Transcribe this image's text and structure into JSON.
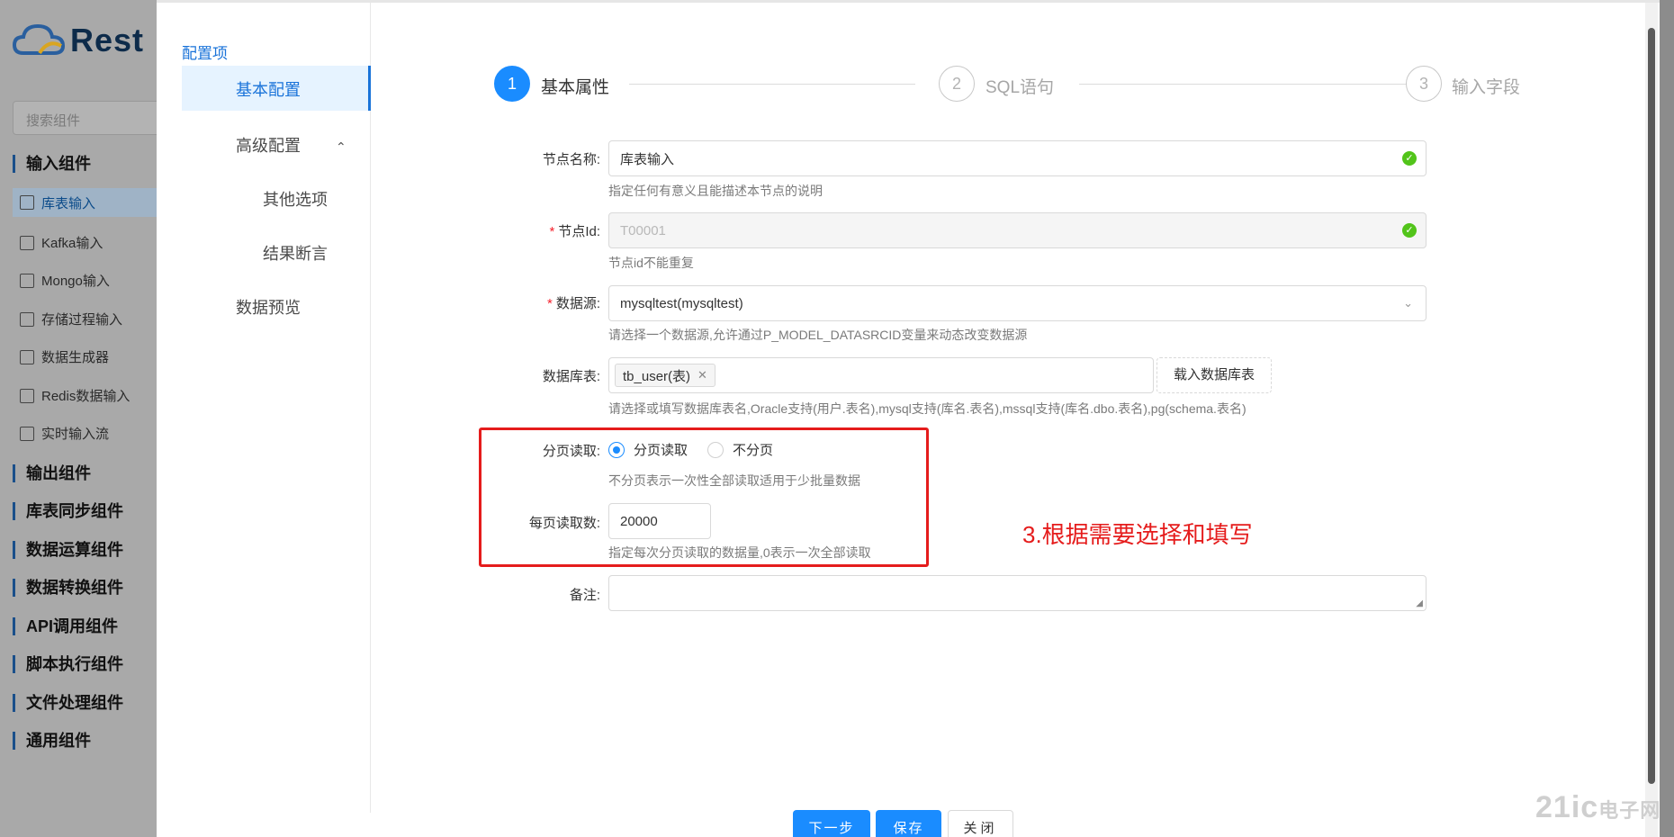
{
  "app": {
    "logo_text": "Rest"
  },
  "sidebar": {
    "search_placeholder": "搜索组件",
    "groups": [
      {
        "label": "输入组件"
      },
      {
        "label": "输出组件"
      },
      {
        "label": "库表同步组件"
      },
      {
        "label": "数据运算组件"
      },
      {
        "label": "数据转换组件"
      },
      {
        "label": "API调用组件"
      },
      {
        "label": "脚本执行组件"
      },
      {
        "label": "文件处理组件"
      },
      {
        "label": "通用组件"
      }
    ],
    "items": [
      {
        "label": "库表输入",
        "active": true
      },
      {
        "label": "Kafka输入"
      },
      {
        "label": "Mongo输入"
      },
      {
        "label": "存储过程输入"
      },
      {
        "label": "数据生成器"
      },
      {
        "label": "Redis数据输入"
      },
      {
        "label": "实时输入流"
      }
    ]
  },
  "modal": {
    "nav": {
      "header": "配置项",
      "items": [
        {
          "label": "基本配置",
          "active": true
        },
        {
          "label": "高级配置",
          "expanded": true
        },
        {
          "label": "其他选项"
        },
        {
          "label": "结果断言"
        },
        {
          "label": "数据预览"
        }
      ]
    },
    "steps": [
      {
        "number": "1",
        "label": "基本属性",
        "status": "done"
      },
      {
        "number": "2",
        "label": "SQL语句",
        "status": "todo"
      },
      {
        "number": "3",
        "label": "输入字段",
        "status": "todo"
      }
    ],
    "form": {
      "node_name": {
        "label": "节点名称:",
        "value": "库表输入",
        "help": "指定任何有意义且能描述本节点的说明"
      },
      "node_id": {
        "required_mark": "*",
        "label": "节点Id:",
        "value": "T00001",
        "help": "节点id不能重复"
      },
      "datasource": {
        "required_mark": "*",
        "label": "数据源:",
        "value": "mysqltest(mysqltest)",
        "help": "请选择一个数据源,允许通过P_MODEL_DATASRCID变量来动态改变数据源"
      },
      "table": {
        "label": "数据库表:",
        "tags": [
          "tb_user(表)"
        ],
        "load_button": "载入数据库表",
        "help": "请选择或填写数据库表名,Oracle支持(用户.表名),mysql支持(库名.表名),mssql支持(库名.dbo.表名),pg(schema.表名)"
      },
      "paging": {
        "label": "分页读取:",
        "options": [
          "分页读取",
          "不分页"
        ],
        "selected": "分页读取",
        "help": "不分页表示一次性全部读取适用于少批量数据"
      },
      "page_size": {
        "label": "每页读取数:",
        "value": "20000",
        "help": "指定每次分页读取的数据量,0表示一次全部读取"
      },
      "remark": {
        "label": "备注:",
        "value": ""
      }
    },
    "annotation": "3.根据需要选择和填写",
    "footer": {
      "next": "下一步",
      "save": "保存",
      "close": "关闭"
    }
  },
  "colors": {
    "primary": "#1a8cff",
    "annotation": "#e51c1c",
    "success": "#52c41a"
  },
  "watermark": {
    "text": "21ic",
    "sub": "电子网"
  }
}
